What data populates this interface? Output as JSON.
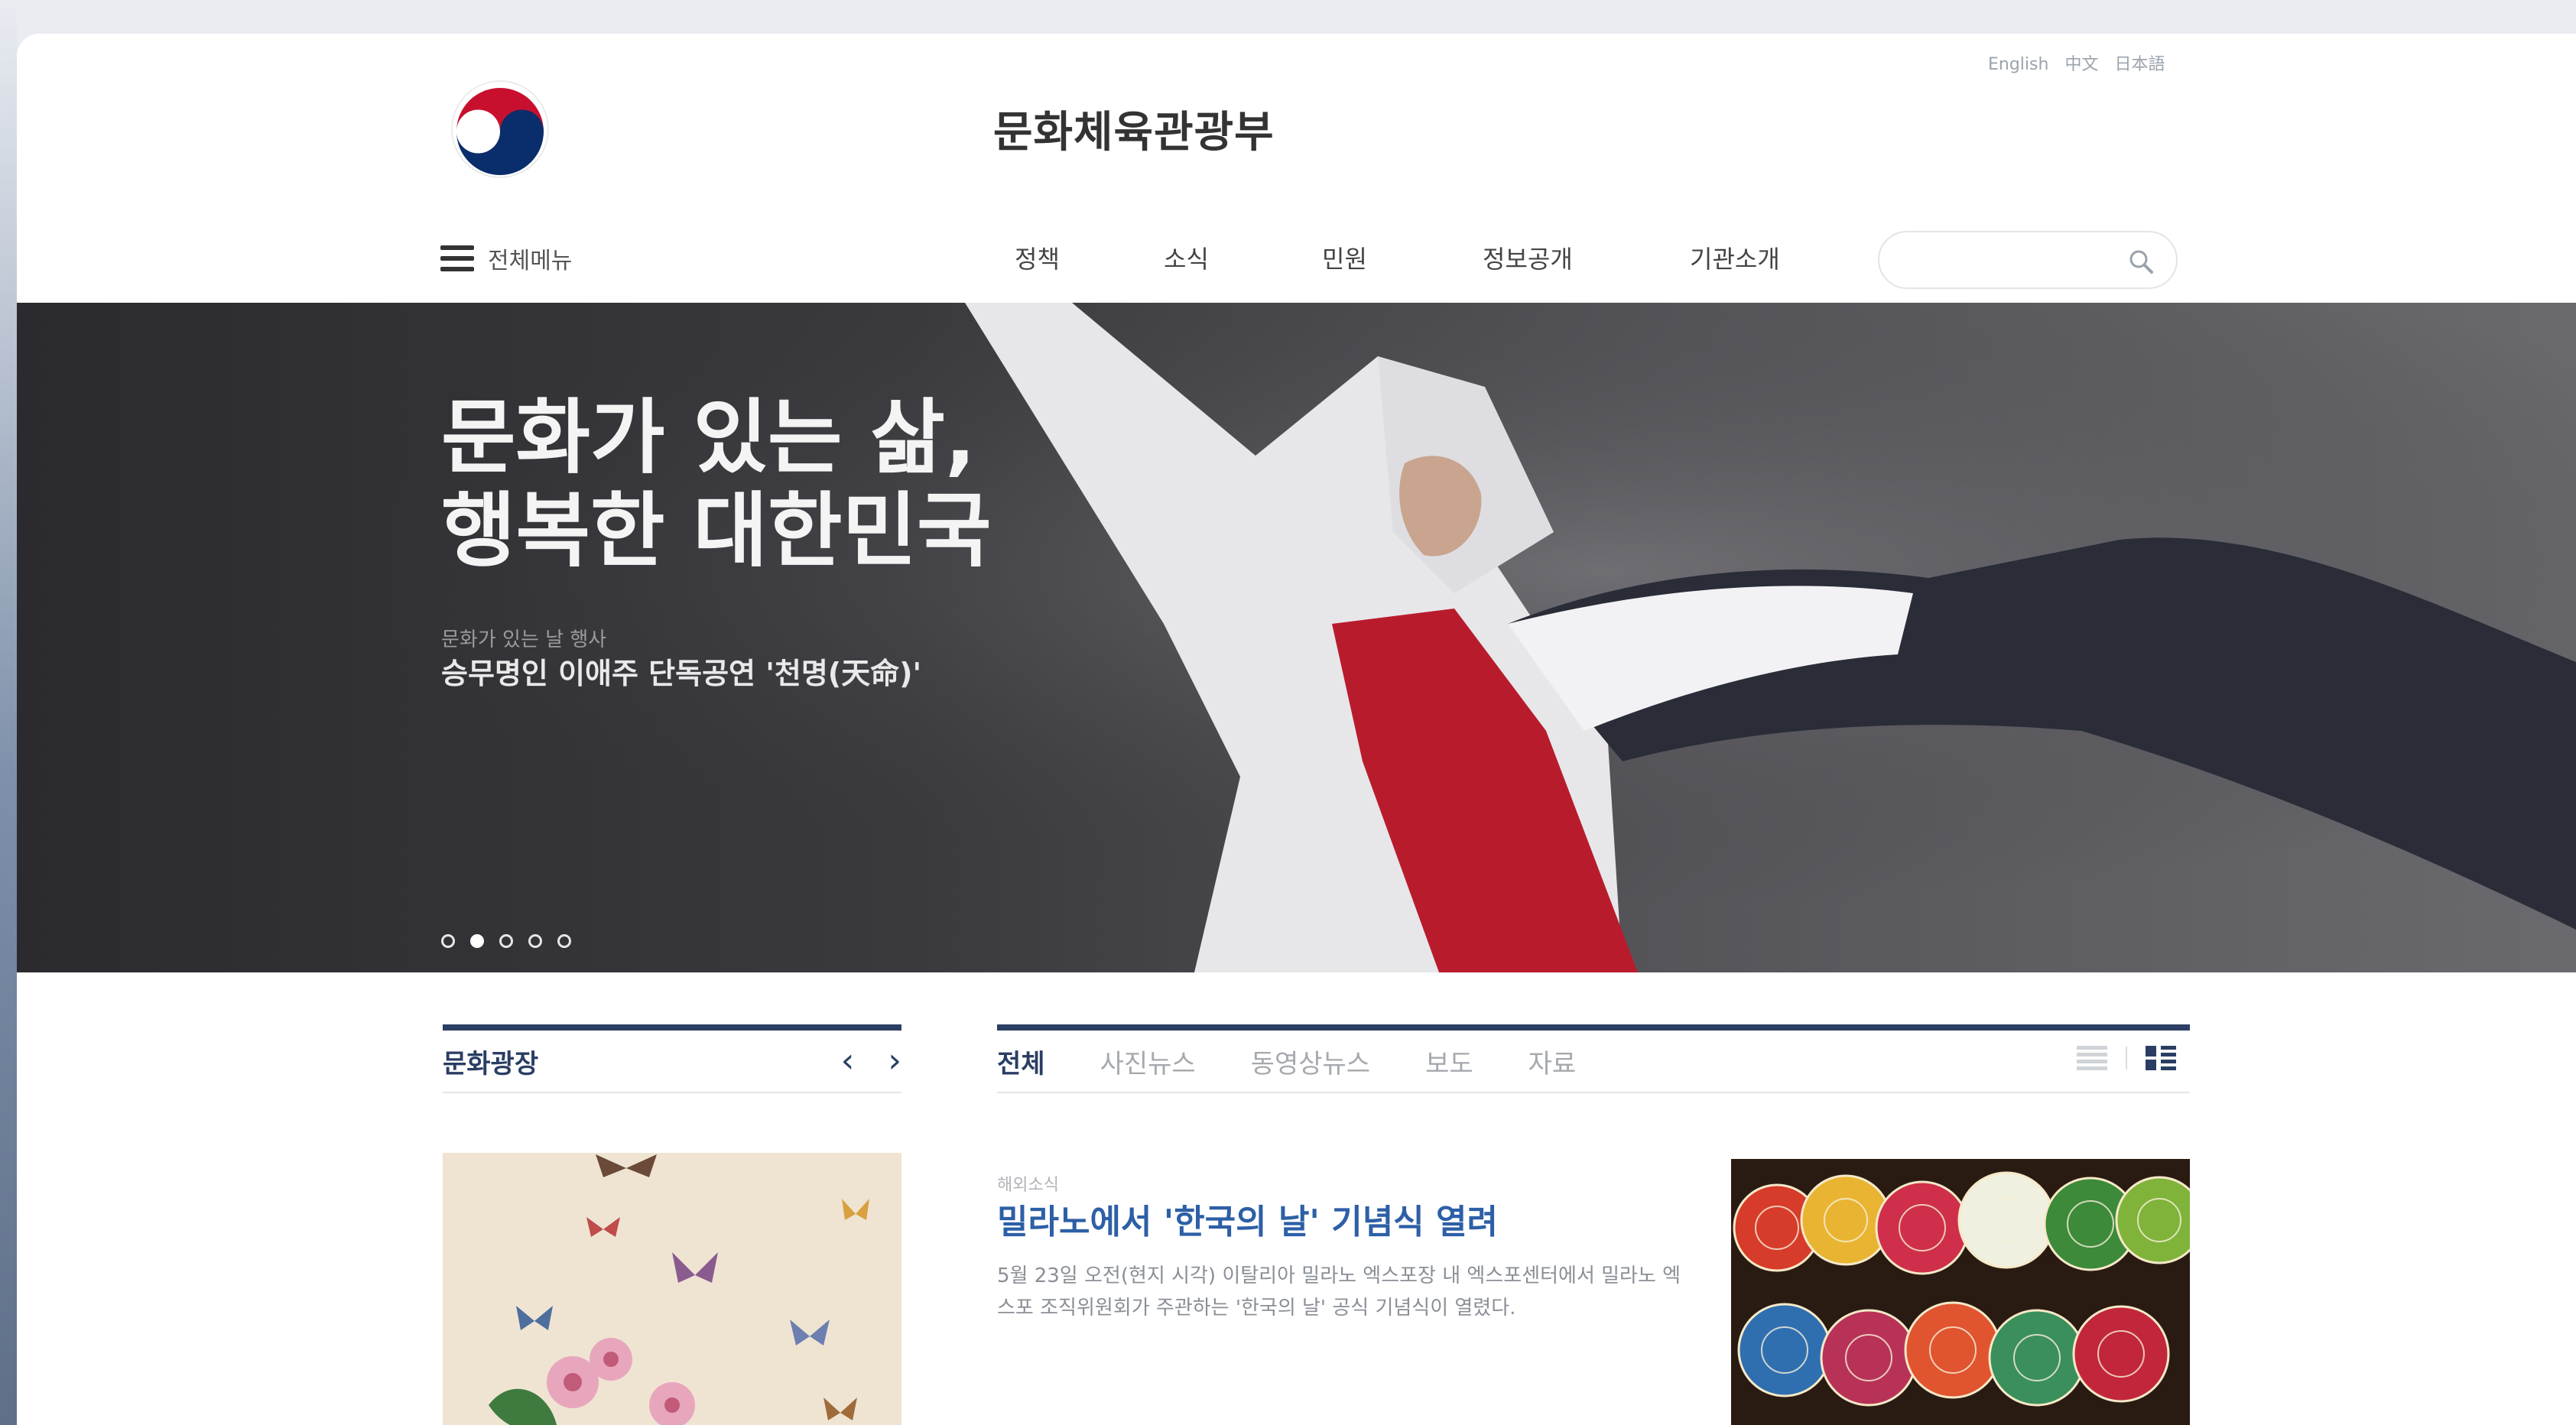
{
  "header": {
    "site_title": "문화체육관광부",
    "languages": [
      "English",
      "中文",
      "日本語"
    ],
    "menu_label": "전체메뉴",
    "nav": [
      "정책",
      "소식",
      "민원",
      "정보공개",
      "기관소개"
    ],
    "search": {
      "value": "",
      "placeholder": ""
    }
  },
  "hero": {
    "title": "문화가 있는 삶,\n행복한 대한민국",
    "eyebrow": "문화가 있는 날 행사",
    "subtitle": "승무명인 이애주 단독공연 '천명(天命)'",
    "slide_count": 5,
    "active_slide": 2
  },
  "culture_plaza": {
    "title": "문화광장"
  },
  "news": {
    "tabs": [
      "전체",
      "사진뉴스",
      "동영상뉴스",
      "보도",
      "자료"
    ],
    "active_tab": 0,
    "article": {
      "category": "해외소식",
      "title": "밀라노에서 '한국의 날' 기념식 열려",
      "body": "5월 23일 오전(현지 시각) 이탈리아 밀라노 엑스포장 내 엑스포센터에서 밀라노 엑스포 조직위원회가 주관하는 '한국의 날' 공식 기념식이 열렸다."
    }
  },
  "colors": {
    "navy": "#2a3e63",
    "link_blue": "#2d5fa6",
    "emblem_red": "#c8102e",
    "emblem_blue": "#0a2d6b"
  },
  "icons": [
    "korea-emblem-icon",
    "hamburger-icon",
    "search-icon",
    "chevron-left-icon",
    "chevron-right-icon",
    "list-view-icon",
    "grid-view-icon"
  ]
}
